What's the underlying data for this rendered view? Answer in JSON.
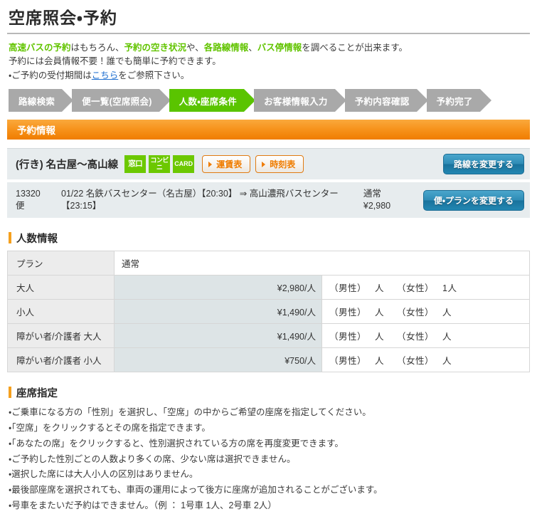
{
  "page": {
    "title": "空席照会・予約"
  },
  "intro": {
    "line1_a": "高速バスの予約",
    "line1_b": "はもちろん、",
    "line1_c": "予約の空き状況",
    "line1_d": "や、",
    "line1_e": "各路線情報",
    "line1_f": "、",
    "line1_g": "バス停情報",
    "line1_h": "を調べることが出来ます。",
    "line2": "予約には会員情報不要！誰でも簡単に予約できます。",
    "line3_a": "・ご予約の受付期間は",
    "line3_link": "こちら",
    "line3_b": "をご参照下さい。"
  },
  "steps": [
    {
      "label": "路線検索",
      "active": false
    },
    {
      "label": "便一覧(空席照会)",
      "active": false
    },
    {
      "label": "人数・座席条件",
      "active": true
    },
    {
      "label": "お客様情報入力",
      "active": false
    },
    {
      "label": "予約内容確認",
      "active": false
    },
    {
      "label": "予約完了",
      "active": false
    }
  ],
  "reservation_bar": {
    "label": "予約情報"
  },
  "route": {
    "name": "(行き) 名古屋～高山線",
    "badges": [
      {
        "name": "window-badge",
        "text": "窓口"
      },
      {
        "name": "convenience-store-badge",
        "text": "コンビニ",
        "two_line": true
      },
      {
        "name": "card-badge",
        "text": "CARD"
      }
    ],
    "fare_table_button": "運賃表",
    "timetable_button": "時刻表",
    "change_route_button": "路線を変更する"
  },
  "bus": {
    "number": "13320便",
    "number_line1": "13320",
    "number_line2": "便",
    "detail": "01/22 名鉄バスセンター（名古屋）【20:30】 ⇒ 高山濃飛バスセンター【23:15】",
    "detail_line1": "01/22 名鉄バスセンター（名古屋）【20:30】 ⇒ 高山濃飛バスセンター",
    "detail_line2": "【23:15】",
    "fare_label": "通常",
    "fare_amount": "¥2,980",
    "change_plan_button": "便・プランを変更する"
  },
  "passenger_section": {
    "heading": "人数情報",
    "header_plan_label": "プラン",
    "header_plan_value": "通常",
    "rows": [
      {
        "category": "大人",
        "price": "¥2,980/人",
        "male_label": "（男性）",
        "male_count": "人",
        "female_label": "（女性）",
        "female_count": "1人"
      },
      {
        "category": "小人",
        "price": "¥1,490/人",
        "male_label": "（男性）",
        "male_count": "人",
        "female_label": "（女性）",
        "female_count": "人"
      },
      {
        "category": "障がい者/介護者 大人",
        "price": "¥1,490/人",
        "male_label": "（男性）",
        "male_count": "人",
        "female_label": "（女性）",
        "female_count": "人"
      },
      {
        "category": "障がい者/介護者 小人",
        "price": "¥750/人",
        "male_label": "（男性）",
        "male_count": "人",
        "female_label": "（女性）",
        "female_count": "人"
      }
    ]
  },
  "seat_section": {
    "heading": "座席指定",
    "notes": [
      "・ご乗車になる方の「性別」を選択し、「空席」の中からご希望の座席を指定してください。",
      "・「空席」をクリックするとその席を指定できます。",
      "・「あなたの席」をクリックすると、性別選択されている方の席を再度変更できます。",
      "・ご予約した性別ごとの人数より多くの席、少ない席は選択できません。",
      "・選択した席には大人小人の区別はありません。",
      "・最後部座席を選択されても、車両の運用によって後方に座席が追加されることがございます。",
      "・号車をまたいだ予約はできません。（例 ： 1号車 1人、2号車 2人）"
    ]
  },
  "colors": {
    "accent_green": "#5ac400",
    "badge_green": "#6cc800",
    "orange": "#f7941e",
    "button_orange": "#ef7c00",
    "blue_button": "#2f8cb6",
    "link_blue": "#1f6fd0",
    "panel_bg": "#e7ecee",
    "price_cell_bg": "#dde4e6",
    "table_header_bg": "#ececec"
  }
}
